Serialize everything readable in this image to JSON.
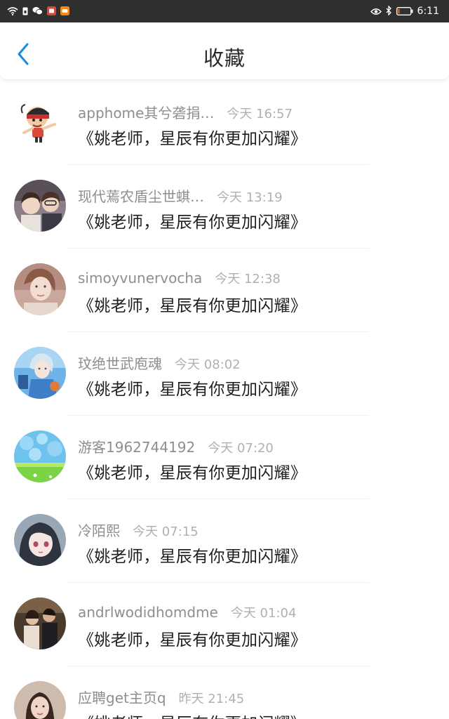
{
  "status_bar": {
    "time": "6:11",
    "icons_left": [
      "wifi-icon",
      "sim-icon",
      "wechat-icon",
      "notification-icon",
      "game-icon"
    ],
    "icons_right": [
      "eye-icon",
      "bluetooth-icon",
      "battery-icon"
    ],
    "battery_level": 0.12,
    "colors": {
      "background": "#2f2f2f",
      "notify_red": "#e0413b",
      "notify_orange": "#f08a1d",
      "battery_low": "#f06a2a"
    }
  },
  "header": {
    "title": "收藏",
    "back_icon": "chevron-left-icon",
    "accent_color": "#1a8ce0"
  },
  "items": [
    {
      "username": "apphome其兮砻捐…",
      "time": "今天 16:57",
      "message": "《姚老师，星辰有你更加闪耀》",
      "avatar": "cartoon-character"
    },
    {
      "username": "现代蔫农盾尘世蜞…",
      "time": "今天 13:19",
      "message": "《姚老师，星辰有你更加闪耀》",
      "avatar": "two-girls-photo"
    },
    {
      "username": "simoyvunervocha",
      "time": "今天 12:38",
      "message": "《姚老师，星辰有你更加闪耀》",
      "avatar": "girl-portrait"
    },
    {
      "username": "玟绝世武庖魂",
      "time": "今天 08:02",
      "message": "《姚老师，星辰有你更加闪耀》",
      "avatar": "anime-boy"
    },
    {
      "username": "游客1962744192",
      "time": "今天 07:20",
      "message": "《姚老师，星辰有你更加闪耀》",
      "avatar": "blue-sky-bokeh"
    },
    {
      "username": "冷陌熙",
      "time": "今天 07:15",
      "message": "《姚老师，星辰有你更加闪耀》",
      "avatar": "anime-girl"
    },
    {
      "username": "andrlwodidhomdme",
      "time": "今天 01:04",
      "message": "《姚老师，星辰有你更加闪耀》",
      "avatar": "couple-photo"
    },
    {
      "username": "应聘get主页q",
      "time": "昨天 21:45",
      "message": "《姚老师，星辰有你更加闪耀》",
      "avatar": "woman-photo"
    }
  ]
}
